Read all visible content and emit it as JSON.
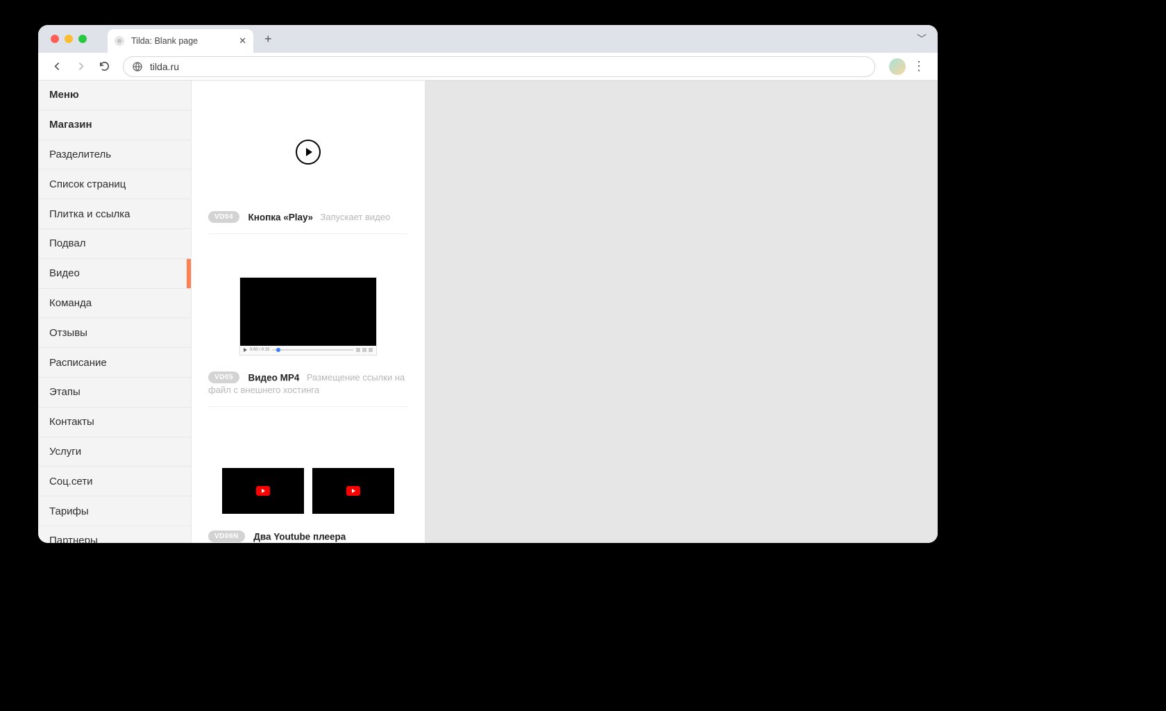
{
  "browser": {
    "tab_title": "Tilda: Blank page",
    "url": "tilda.ru"
  },
  "sidebar": {
    "items": [
      {
        "label": "Меню",
        "bold": true
      },
      {
        "label": "Магазин",
        "bold": true
      },
      {
        "label": "Разделитель"
      },
      {
        "label": "Список страниц"
      },
      {
        "label": "Плитка и ссылка"
      },
      {
        "label": "Подвал"
      },
      {
        "label": "Видео",
        "active": true
      },
      {
        "label": "Команда"
      },
      {
        "label": "Отзывы"
      },
      {
        "label": "Расписание"
      },
      {
        "label": "Этапы"
      },
      {
        "label": "Контакты"
      },
      {
        "label": "Услуги"
      },
      {
        "label": "Соц.сети"
      },
      {
        "label": "Тарифы"
      },
      {
        "label": "Партнеры"
      }
    ]
  },
  "blocks": {
    "vd04": {
      "code": "VD04",
      "title": "Кнопка «Play»",
      "desc": "Запускает видео"
    },
    "vd05": {
      "code": "VD05",
      "title": "Видео MP4",
      "desc": "Размещение ссылки на файл с внешнего хостинга",
      "time": "0:00 / 0:15"
    },
    "vd06n": {
      "code": "VD06N",
      "title": "Два Youtube плеера"
    }
  }
}
